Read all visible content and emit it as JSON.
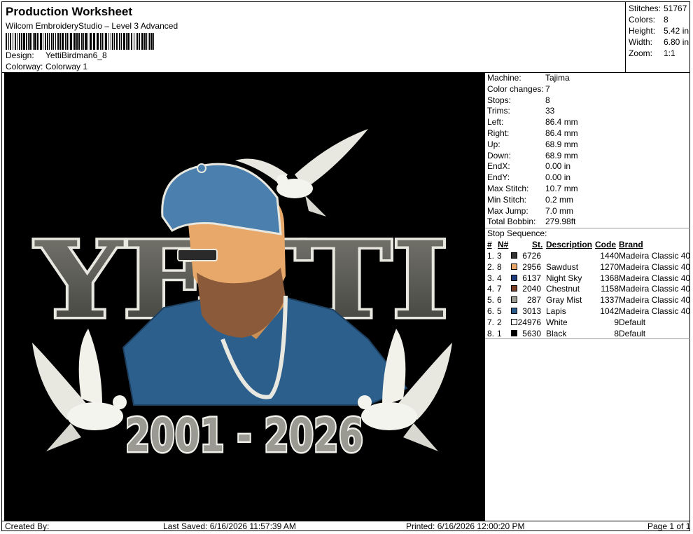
{
  "header": {
    "title": "Production Worksheet",
    "subtitle": "Wilcom EmbroideryStudio – Level 3 Advanced",
    "design_label": "Design:",
    "design_value": "YettiBirdman6_8",
    "colorway_label": "Colorway:",
    "colorway_value": "Colorway 1"
  },
  "summary": [
    {
      "label": "Stitches:",
      "value": "51767"
    },
    {
      "label": "Colors:",
      "value": "8"
    },
    {
      "label": "Height:",
      "value": "5.42 in"
    },
    {
      "label": "Width:",
      "value": "6.80 in"
    },
    {
      "label": "Zoom:",
      "value": "1:1"
    }
  ],
  "artwork": {
    "text_top": "YETTI",
    "text_bottom": "2001 - 2026"
  },
  "machine_info": [
    {
      "label": "Machine:",
      "value": "Tajima"
    },
    {
      "label": "Color changes:",
      "value": "7"
    },
    {
      "label": "Stops:",
      "value": "8"
    },
    {
      "label": "Trims:",
      "value": "33"
    },
    {
      "label": "Left:",
      "value": "86.4 mm"
    },
    {
      "label": "Right:",
      "value": "86.4 mm"
    },
    {
      "label": "Up:",
      "value": "68.9 mm"
    },
    {
      "label": "Down:",
      "value": "68.9 mm"
    },
    {
      "label": "EndX:",
      "value": "0.00 in"
    },
    {
      "label": "EndY:",
      "value": "0.00 in"
    },
    {
      "label": "Max Stitch:",
      "value": "10.7 mm"
    },
    {
      "label": "Min Stitch:",
      "value": "0.2 mm"
    },
    {
      "label": "Max Jump:",
      "value": "7.0 mm"
    },
    {
      "label": "Total Bobbin:",
      "value": "279.98ft"
    }
  ],
  "stop_sequence": {
    "title": "Stop Sequence:",
    "headers": {
      "num": "#",
      "n": "N#",
      "st": "St.",
      "desc": "Description",
      "code": "Code",
      "brand": "Brand"
    },
    "rows": [
      {
        "num": "1.",
        "n": "3",
        "color": "#333333",
        "st": "6726",
        "desc": "",
        "code": "1440",
        "brand": "Madeira Classic 40"
      },
      {
        "num": "2.",
        "n": "8",
        "color": "#E8A66A",
        "st": "2956",
        "desc": "Sawdust",
        "code": "1270",
        "brand": "Madeira Classic 40"
      },
      {
        "num": "3.",
        "n": "4",
        "color": "#1F3D7A",
        "st": "6137",
        "desc": "Night Sky",
        "code": "1368",
        "brand": "Madeira Classic 40"
      },
      {
        "num": "4.",
        "n": "7",
        "color": "#7A3F26",
        "st": "2040",
        "desc": "Chestnut",
        "code": "1158",
        "brand": "Madeira Classic 40"
      },
      {
        "num": "5.",
        "n": "6",
        "color": "#9A9A90",
        "st": "287",
        "desc": "Gray Mist",
        "code": "1337",
        "brand": "Madeira Classic 40"
      },
      {
        "num": "6.",
        "n": "5",
        "color": "#2B5C8C",
        "st": "3013",
        "desc": "Lapis",
        "code": "1042",
        "brand": "Madeira Classic 40"
      },
      {
        "num": "7.",
        "n": "2",
        "color": "#FFFFFF",
        "st": "24976",
        "desc": "White",
        "code": "9",
        "brand": "Default"
      },
      {
        "num": "8.",
        "n": "1",
        "color": "#000000",
        "st": "5630",
        "desc": "Black",
        "code": "8",
        "brand": "Default"
      }
    ]
  },
  "footer": {
    "created": "Created By:",
    "last_saved": "Last Saved: 6/16/2026 11:57:39 AM",
    "printed": "Printed: 6/16/2026 12:00:20 PM",
    "page": "Page 1 of 1"
  }
}
